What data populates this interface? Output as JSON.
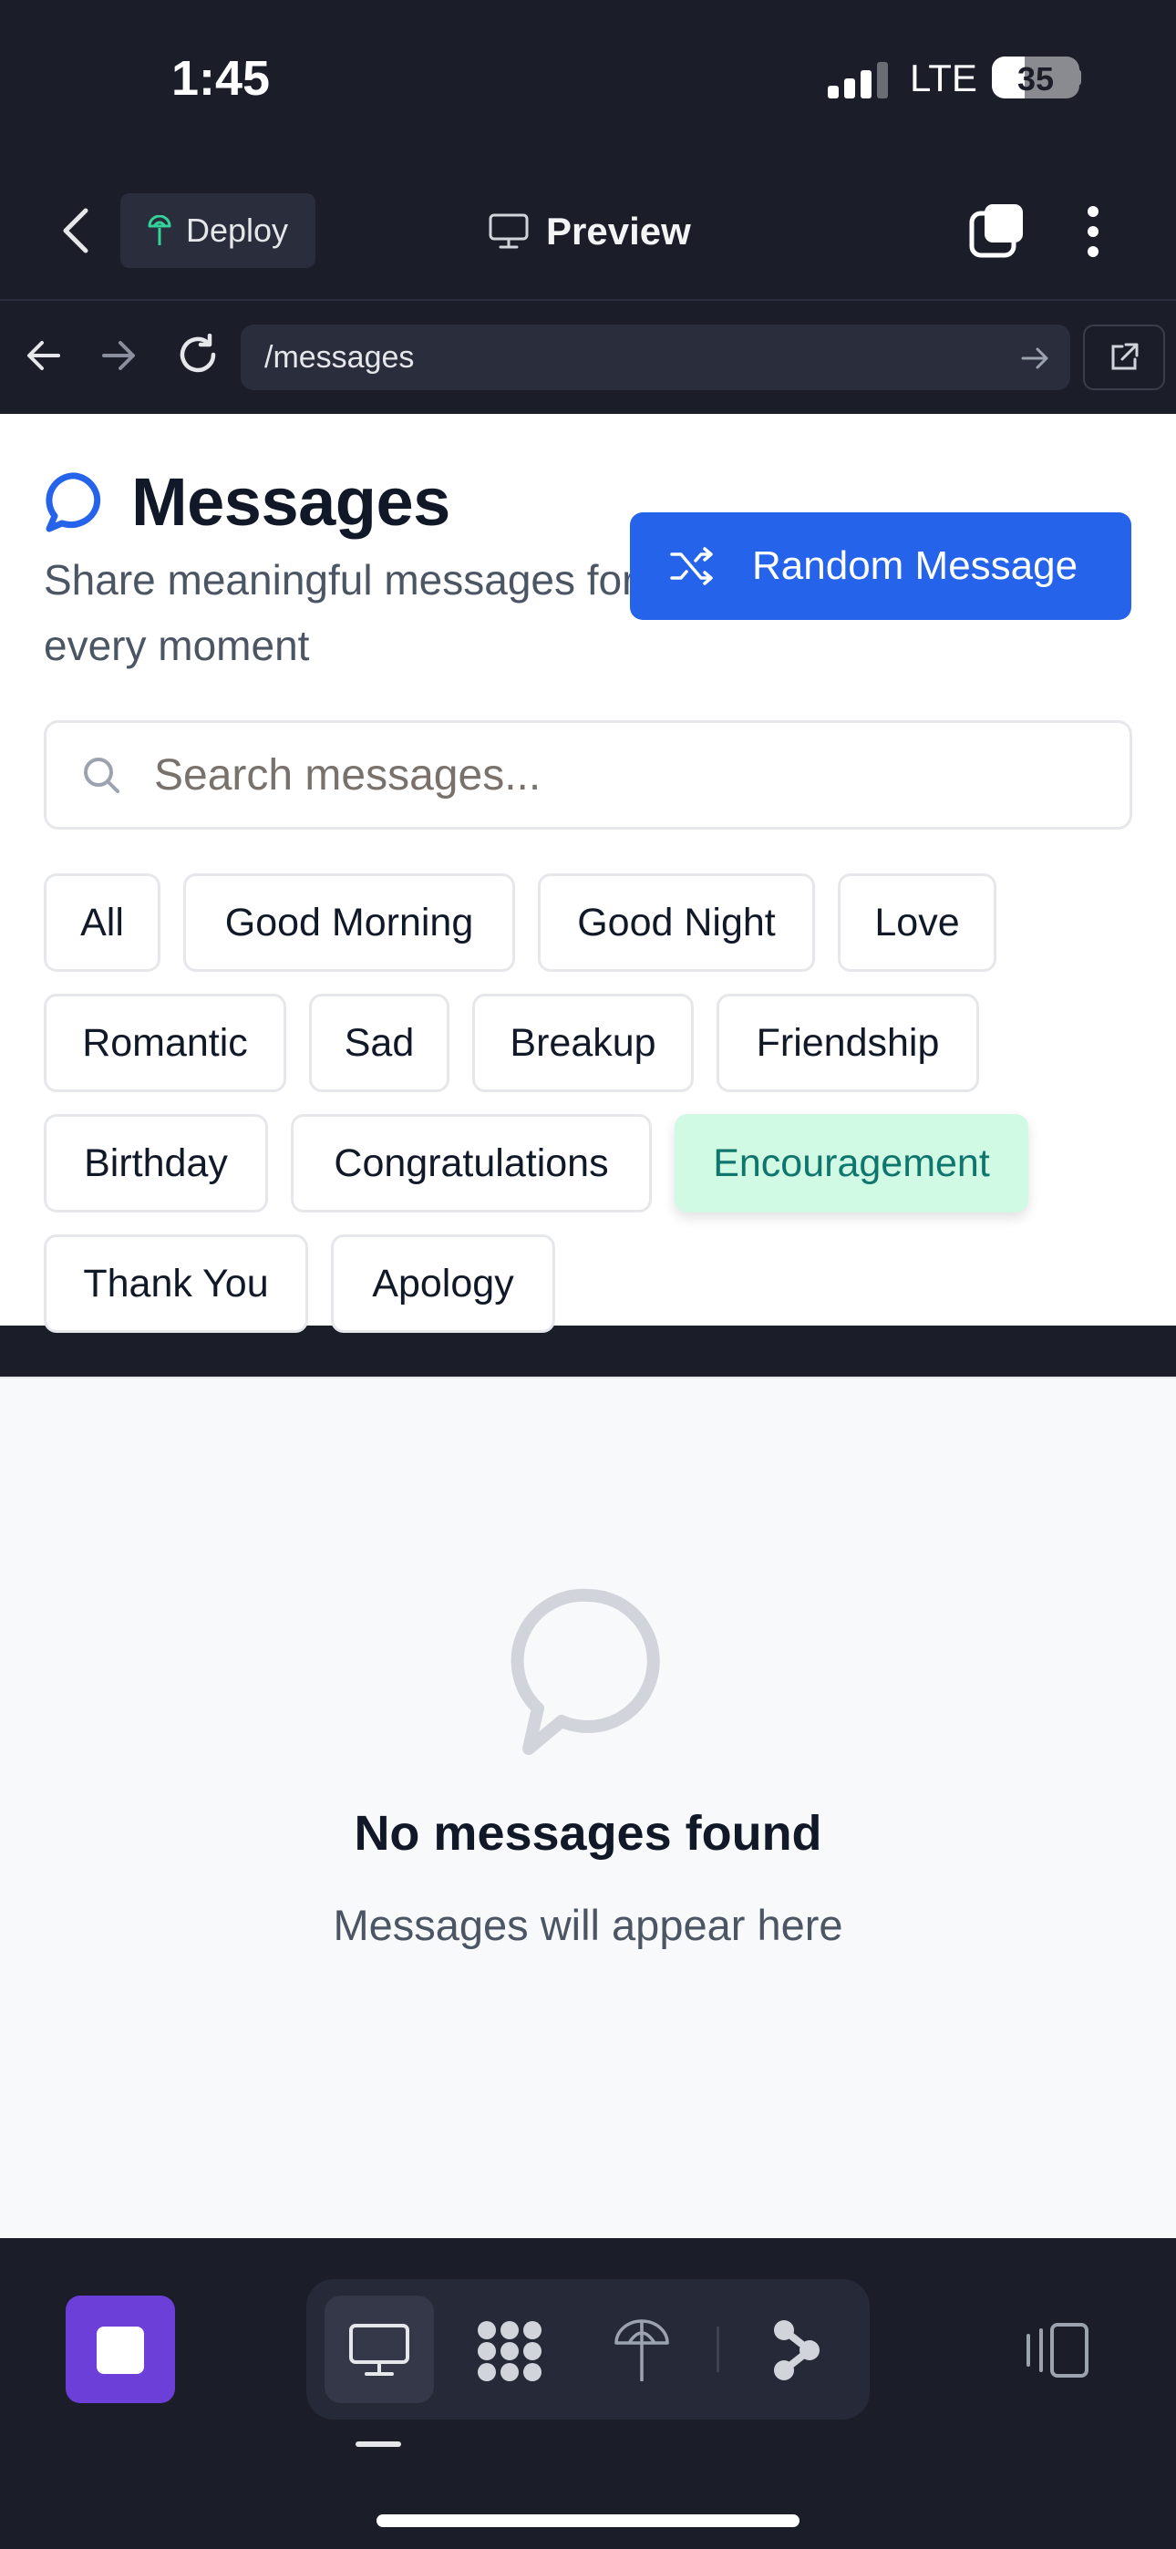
{
  "status_bar": {
    "time": "1:45",
    "carrier": "LTE",
    "battery": "35"
  },
  "toolbar": {
    "deploy_label": "Deploy",
    "preview_label": "Preview"
  },
  "browser": {
    "url": "/messages"
  },
  "page": {
    "title": "Messages",
    "subtitle": "Share meaningful messages for every moment",
    "random_button": "Random Message",
    "search_placeholder": "Search messages...",
    "categories": [
      "All",
      "Good Morning",
      "Good Night",
      "Love",
      "Romantic",
      "Sad",
      "Breakup",
      "Friendship",
      "Birthday",
      "Congratulations",
      "Encouragement",
      "Thank You",
      "Apology"
    ],
    "active_category": "Encouragement",
    "empty_title": "No messages found",
    "empty_subtitle": "Messages will appear here"
  },
  "colors": {
    "accent": "#2563eb",
    "active_chip_bg": "#d1fae5",
    "active_chip_text": "#0f766e",
    "stop_button": "#6d3fd9"
  },
  "icons": [
    "chevron-left-icon",
    "sprout-icon",
    "monitor-icon",
    "tabs-icon",
    "kebab-icon",
    "arrow-left-icon",
    "arrow-right-icon",
    "reload-icon",
    "external-link-icon",
    "chat-bubble-icon",
    "shuffle-icon",
    "search-icon",
    "stop-icon",
    "desktop-icon",
    "apps-grid-icon",
    "deploy-icon",
    "branch-icon",
    "side-panel-icon"
  ]
}
